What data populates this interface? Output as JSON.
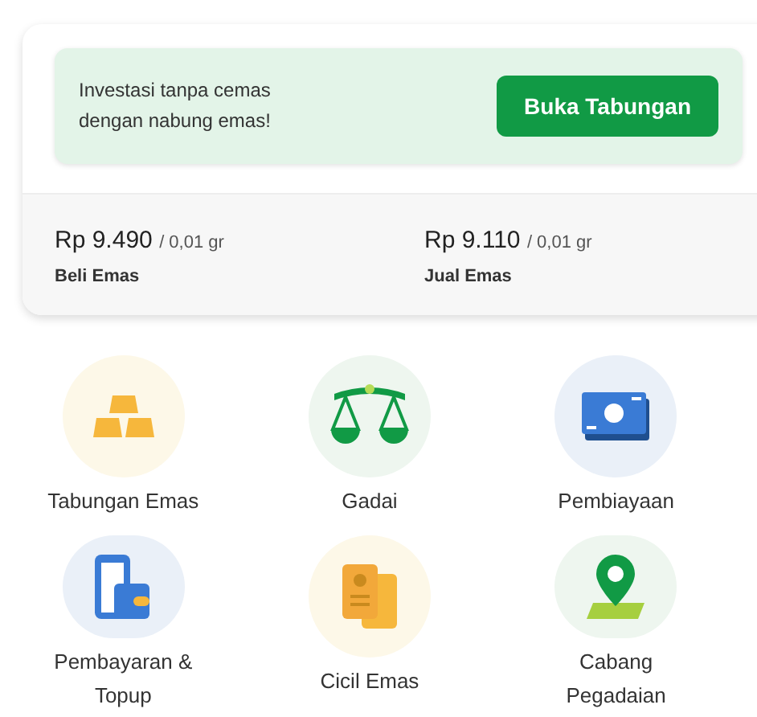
{
  "banner": {
    "text": "Investasi tanpa cemas dengan nabung emas!",
    "button": "Buka Tabungan"
  },
  "prices": [
    {
      "amount": "Rp 9.490",
      "unit": "/ 0,01 gr",
      "label": "Beli Emas"
    },
    {
      "amount": "Rp 9.110",
      "unit": "/ 0,01 gr",
      "label": "Jual Emas"
    }
  ],
  "menu": [
    {
      "label": "Tabungan Emas",
      "kind": "gold"
    },
    {
      "label": "Gadai",
      "kind": "scale"
    },
    {
      "label": "Pembiayaan",
      "kind": "money"
    },
    {
      "label": "Pembayaran & Topup",
      "kind": "wallet"
    },
    {
      "label": "Cicil Emas",
      "kind": "document"
    },
    {
      "label": "Cabang Pegadaian",
      "kind": "pin"
    }
  ]
}
